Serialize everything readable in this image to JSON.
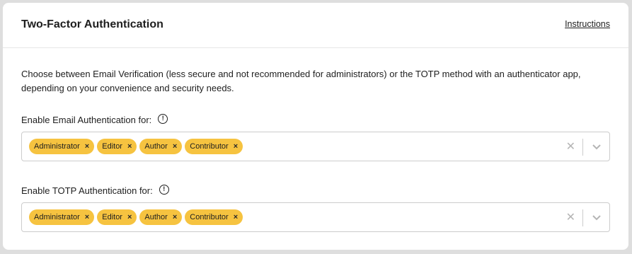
{
  "panel": {
    "title": "Two-Factor Authentication",
    "instructions_link": "Instructions",
    "description": "Choose between Email Verification (less secure and not recommended for administrators) or the TOTP method with an authenticator app, depending on your convenience and security needs."
  },
  "email_field": {
    "label": "Enable Email Authentication for:",
    "info_icon": "info-circle-icon",
    "selected": [
      "Administrator",
      "Editor",
      "Author",
      "Contributor"
    ],
    "remove_glyph": "×",
    "clear_glyph": "✕"
  },
  "totp_field": {
    "label": "Enable TOTP Authentication for:",
    "info_icon": "info-circle-icon",
    "selected": [
      "Administrator",
      "Editor",
      "Author",
      "Contributor"
    ],
    "remove_glyph": "×",
    "clear_glyph": "✕"
  },
  "colors": {
    "tag_background": "#f6c340",
    "card_background": "#ffffff",
    "page_background": "#dedede",
    "border": "#cccccc"
  }
}
